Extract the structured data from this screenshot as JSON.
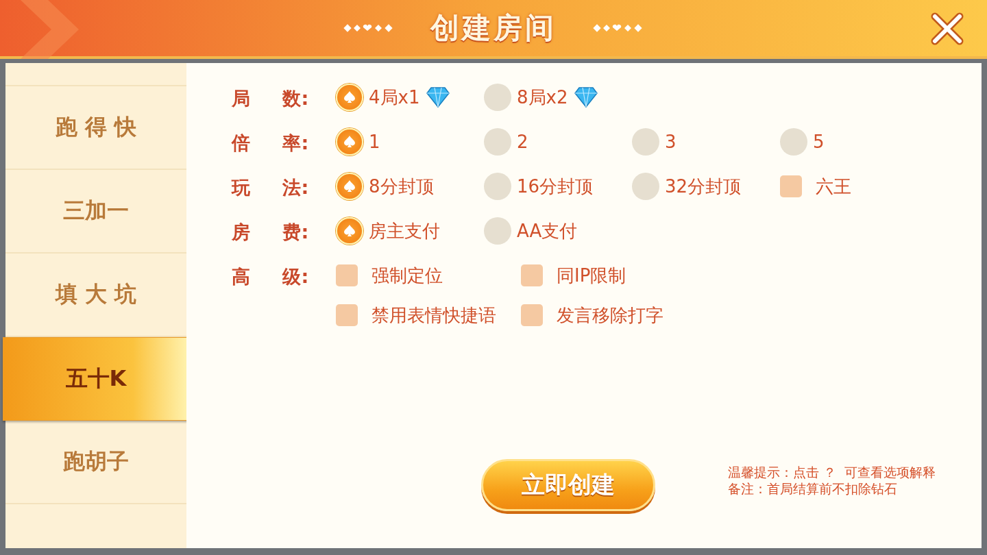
{
  "title": "创建房间",
  "sidebar": {
    "items": [
      {
        "label": "跑 得 快",
        "selected": false
      },
      {
        "label": "三加一",
        "selected": false
      },
      {
        "label": "填 大 坑",
        "selected": false
      },
      {
        "label": "五十K",
        "selected": true
      },
      {
        "label": "跑胡子",
        "selected": false
      }
    ]
  },
  "settings": [
    {
      "label": "局 数:",
      "options": [
        {
          "kind": "radio",
          "text": "4局x1",
          "selected": true,
          "gem": true
        },
        {
          "kind": "radio",
          "text": "8局x2",
          "selected": false,
          "gem": true
        }
      ]
    },
    {
      "label": "倍 率:",
      "options": [
        {
          "kind": "radio",
          "text": "1",
          "selected": true
        },
        {
          "kind": "radio",
          "text": "2",
          "selected": false
        },
        {
          "kind": "radio",
          "text": "3",
          "selected": false
        },
        {
          "kind": "radio",
          "text": "5",
          "selected": false
        }
      ]
    },
    {
      "label": "玩 法:",
      "options": [
        {
          "kind": "radio",
          "text": "8分封顶",
          "selected": true
        },
        {
          "kind": "radio",
          "text": "16分封顶",
          "selected": false
        },
        {
          "kind": "radio",
          "text": "32分封顶",
          "selected": false
        },
        {
          "kind": "checkbox",
          "text": "六王",
          "checked": false
        }
      ]
    },
    {
      "label": "房 费:",
      "options": [
        {
          "kind": "radio",
          "text": "房主支付",
          "selected": true
        },
        {
          "kind": "radio",
          "text": "AA支付",
          "selected": false
        }
      ]
    },
    {
      "label": "高 级:",
      "options": [
        {
          "kind": "checkbox",
          "text": "强制定位",
          "checked": false
        },
        {
          "kind": "checkbox",
          "text": "同IP限制",
          "checked": false
        },
        {
          "kind": "checkbox",
          "text": "禁用表情快捷语",
          "checked": false
        },
        {
          "kind": "checkbox",
          "text": "发言移除打字",
          "checked": false
        }
      ]
    }
  ],
  "create_button": "立即创建",
  "notes": [
    "温馨提示：点击 ？  可查看选项解释",
    "备注：首局结算前不扣除钻石"
  ]
}
